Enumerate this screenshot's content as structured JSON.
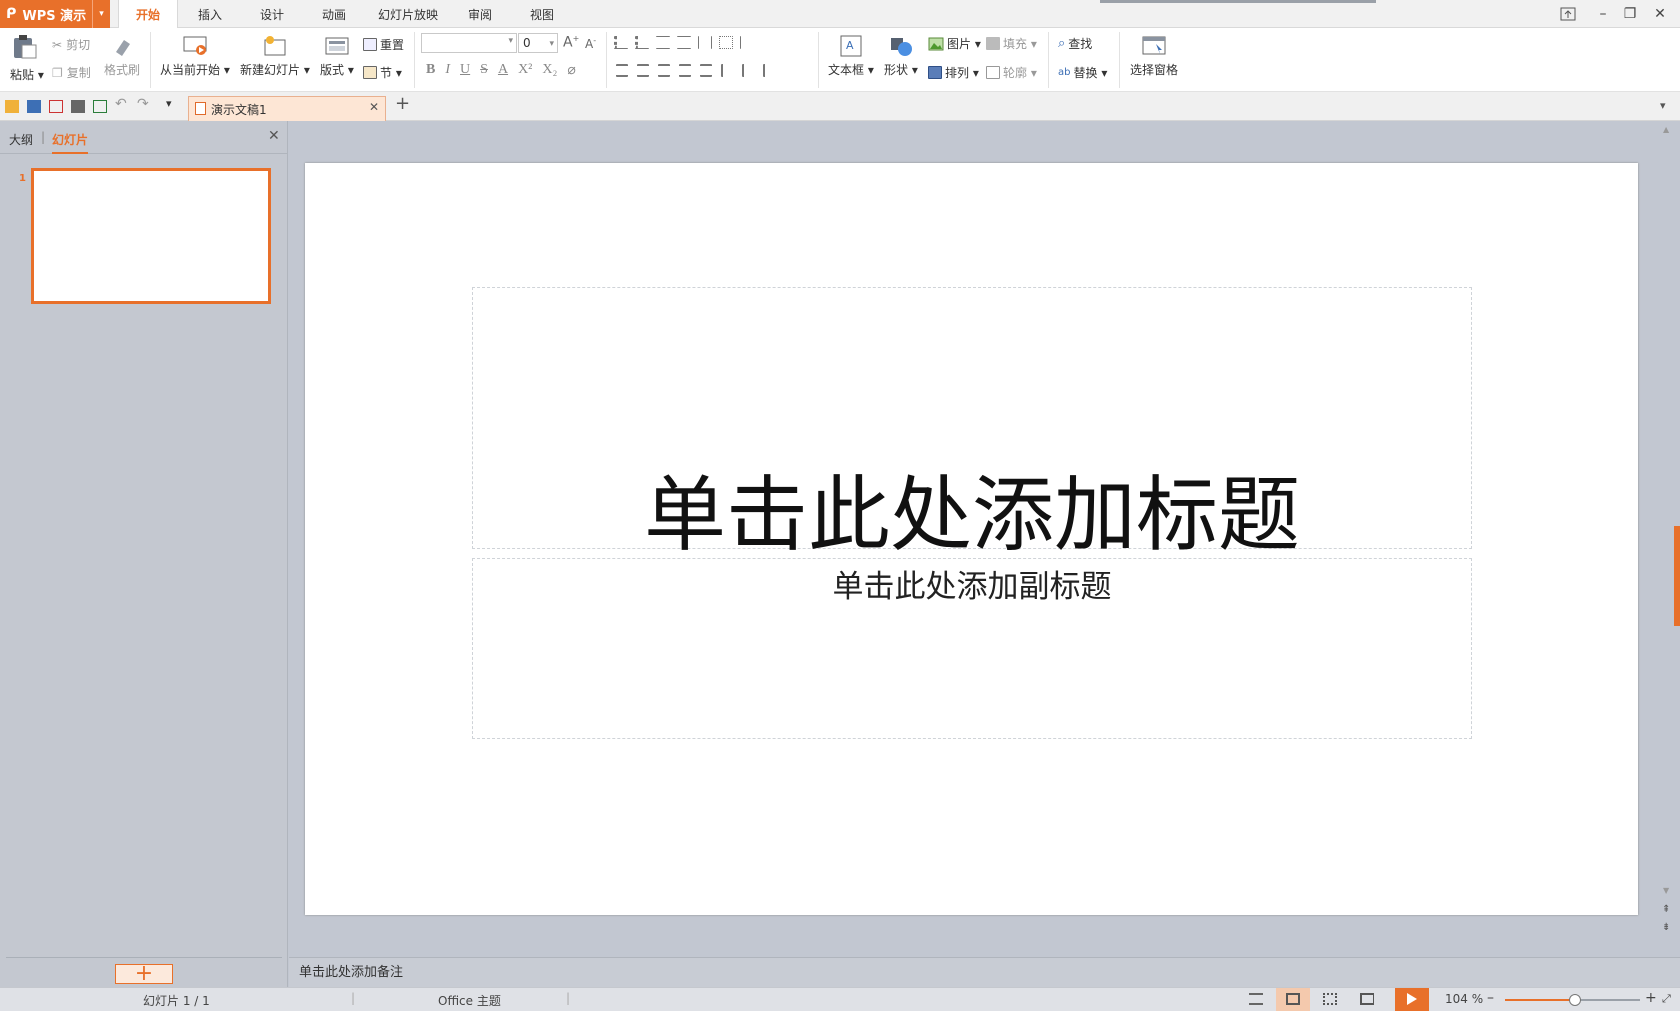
{
  "app": {
    "name": "WPS 演示"
  },
  "tabs": [
    {
      "label": "开始",
      "active": true
    },
    {
      "label": "插入"
    },
    {
      "label": "设计"
    },
    {
      "label": "动画"
    },
    {
      "label": "幻灯片放映"
    },
    {
      "label": "审阅"
    },
    {
      "label": "视图"
    }
  ],
  "ribbon": {
    "paste": "粘贴",
    "cut": "剪切",
    "copy": "复制",
    "format_painter": "格式刷",
    "from_current": "从当前开始",
    "new_slide": "新建幻灯片",
    "layout": "版式",
    "reset": "重置",
    "section": "节",
    "font_name": "",
    "font_size": "0",
    "text_box": "文本框",
    "shape": "形状",
    "picture": "图片",
    "fill": "填充",
    "arrange": "排列",
    "outline": "轮廓",
    "find": "查找",
    "replace": "替换",
    "selection_pane": "选择窗格",
    "fmt_b": "B",
    "fmt_i": "I",
    "fmt_u": "U",
    "fmt_s": "S",
    "fmt_a": "A",
    "sup": "X²",
    "sub": "X₂"
  },
  "doc_tab": {
    "label": "演示文稿1"
  },
  "left_pane": {
    "tab_outline": "大纲",
    "tab_slides": "幻灯片",
    "slide_number": "1"
  },
  "slide": {
    "title_placeholder": "单击此处添加标题",
    "subtitle_placeholder": "单击此处添加副标题"
  },
  "notes": {
    "placeholder": "单击此处添加备注"
  },
  "status": {
    "slide_count": "幻灯片 1 / 1",
    "theme": "Office 主题",
    "zoom": "104 %",
    "zoom_level": 0.52
  },
  "colors": {
    "accent": "#e8702a"
  }
}
